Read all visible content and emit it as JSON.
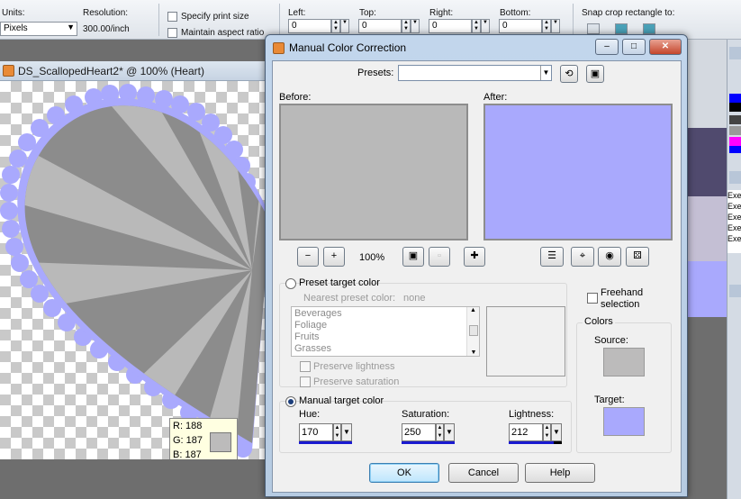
{
  "toolbar": {
    "units_label": "Units:",
    "units_value": "Pixels",
    "resolution_label": "Resolution:",
    "resolution_value": "300.00/inch",
    "specify_print_size": "Specify print size",
    "maintain_aspect_ratio": "Maintain aspect ratio",
    "left_label": "Left:",
    "top_label": "Top:",
    "right_label": "Right:",
    "bottom_label": "Bottom:",
    "left_value": "0",
    "top_value": "0",
    "right_value": "0",
    "bottom_value": "0",
    "snap_label": "Snap crop rectangle to:"
  },
  "document": {
    "title": "DS_ScallopedHeart2* @ 100% (Heart)"
  },
  "tooltip": {
    "r": "R: 188",
    "g": "G: 187",
    "b": "B: 187",
    "swatch_color": "#bcbbbb"
  },
  "dialog": {
    "title": "Manual Color Correction",
    "minimize": "‒",
    "maximize": "□",
    "close": "✕",
    "presets_label": "Presets:",
    "presets_value": "",
    "before_label": "Before:",
    "after_label": "After:",
    "before_color": "#b9b9b9",
    "after_color": "#a9a9fd",
    "zoom_value": "100%",
    "preset_target_label": "Preset target color",
    "nearest_preset_label": "Nearest preset color:",
    "nearest_preset_value": "none",
    "preset_list": [
      "Beverages",
      "Foliage",
      "Fruits",
      "Grasses"
    ],
    "preserve_lightness": "Preserve lightness",
    "preserve_saturation": "Preserve saturation",
    "manual_target_label": "Manual target color",
    "hue_label": "Hue:",
    "hue_value": "170",
    "saturation_label": "Saturation:",
    "saturation_value": "250",
    "lightness_label": "Lightness:",
    "lightness_value": "212",
    "freehand_label_1": "Freehand",
    "freehand_label_2": "selection",
    "colors_label": "Colors",
    "source_label": "Source:",
    "target_label": "Target:",
    "source_color": "#bcbbbb",
    "target_color": "#a9a9fd",
    "ok": "OK",
    "cancel": "Cancel",
    "help": "Help"
  },
  "right_panel": {
    "history_items": [
      "Exe",
      "Exe",
      "Exe",
      "Exe",
      "Exe"
    ]
  }
}
